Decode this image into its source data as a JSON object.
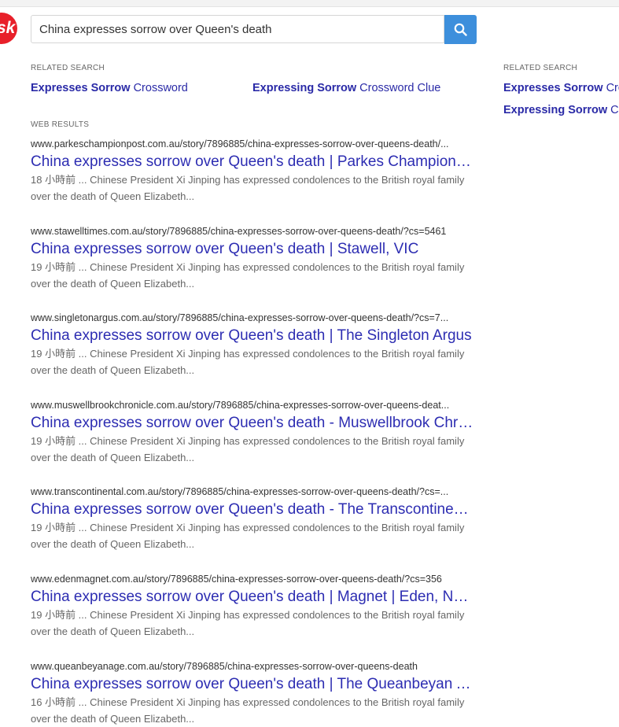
{
  "logo": {
    "text": "sk"
  },
  "search": {
    "value": "China expresses sorrow over Queen's death"
  },
  "related_left": {
    "label": "RELATED SEARCH",
    "items": [
      {
        "bold": "Expresses Sorrow",
        "rest": " Crossword"
      },
      {
        "bold": "Expressing Sorrow",
        "rest": " Crossword Clue"
      }
    ]
  },
  "related_right": {
    "label": "RELATED SEARCH",
    "items": [
      {
        "bold": "Expresses Sorrow",
        "rest": " Cro"
      },
      {
        "bold": "Expressing Sorrow",
        "rest": " Cro"
      }
    ]
  },
  "web_results_label": "WEB RESULTS",
  "results": [
    {
      "url": "www.parkeschampionpost.com.au/story/7896885/china-expresses-sorrow-over-queens-death/...",
      "title": "China expresses sorrow over Queen's death | Parkes Champion-Po...",
      "snippet": "18 小時前 ... Chinese President Xi Jinping has expressed condolences to the British royal family over the death of Queen Elizabeth..."
    },
    {
      "url": "www.stawelltimes.com.au/story/7896885/china-expresses-sorrow-over-queens-death/?cs=5461",
      "title": "China expresses sorrow over Queen's death | Stawell, VIC",
      "snippet": "19 小時前 ... Chinese President Xi Jinping has expressed condolences to the British royal family over the death of Queen Elizabeth..."
    },
    {
      "url": "www.singletonargus.com.au/story/7896885/china-expresses-sorrow-over-queens-death/?cs=7...",
      "title": "China expresses sorrow over Queen's death | The Singleton Argus",
      "snippet": "19 小時前 ... Chinese President Xi Jinping has expressed condolences to the British royal family over the death of Queen Elizabeth..."
    },
    {
      "url": "www.muswellbrookchronicle.com.au/story/7896885/china-expresses-sorrow-over-queens-deat...",
      "title": "China expresses sorrow over Queen's death - Muswellbrook Chroni...",
      "snippet": "19 小時前 ... Chinese President Xi Jinping has expressed condolences to the British royal family over the death of Queen Elizabeth..."
    },
    {
      "url": "www.transcontinental.com.au/story/7896885/china-expresses-sorrow-over-queens-death/?cs=...",
      "title": "China expresses sorrow over Queen's death - The Transcontinental",
      "snippet": "19 小時前 ... Chinese President Xi Jinping has expressed condolences to the British royal family over the death of Queen Elizabeth..."
    },
    {
      "url": "www.edenmagnet.com.au/story/7896885/china-expresses-sorrow-over-queens-death/?cs=356",
      "title": "China expresses sorrow over Queen's death | Magnet | Eden, NSW",
      "snippet": "19 小時前 ... Chinese President Xi Jinping has expressed condolences to the British royal family over the death of Queen Elizabeth..."
    },
    {
      "url": "www.queanbeyanage.com.au/story/7896885/china-expresses-sorrow-over-queens-death",
      "title": "China expresses sorrow over Queen's death | The Queanbeyan Age",
      "snippet": "16 小時前 ... Chinese President Xi Jinping has expressed condolences to the British royal family over the death of Queen Elizabeth..."
    }
  ],
  "colors": {
    "link": "#2d2db2",
    "search_button": "#3d8fdc",
    "logo": "#e8202a"
  }
}
